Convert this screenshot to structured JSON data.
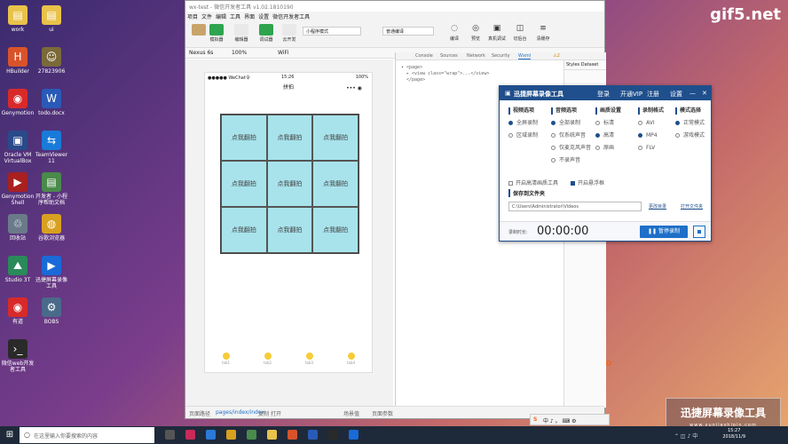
{
  "desktop": {
    "icons": [
      {
        "label": "work",
        "glyph": "▤",
        "color": "#e8c24a"
      },
      {
        "label": "ui",
        "glyph": "▤",
        "color": "#e8c24a"
      },
      {
        "label": "HBuilder",
        "glyph": "H",
        "color": "#d9532a"
      },
      {
        "label": "27823906",
        "glyph": "☺",
        "color": "#7a6a3a"
      },
      {
        "label": "Genymotion",
        "glyph": "◉",
        "color": "#d92a2a"
      },
      {
        "label": "todo.docx",
        "glyph": "W",
        "color": "#2a5ab8"
      },
      {
        "label": "Oracle VM VirtualBox",
        "glyph": "▣",
        "color": "#2a4a8a"
      },
      {
        "label": "TeamViewer 11",
        "glyph": "⇆",
        "color": "#1a7ad8"
      },
      {
        "label": "Genymotion Shell",
        "glyph": "▶",
        "color": "#a82020"
      },
      {
        "label": "开发者 - 小程序帮助文档",
        "glyph": "▤",
        "color": "#4a8a4a"
      },
      {
        "label": "回收站",
        "glyph": "♲",
        "color": "#6a7a8a"
      },
      {
        "label": "谷歌浏览器",
        "glyph": "◍",
        "color": "#d8a020"
      },
      {
        "label": "Studio 3T",
        "glyph": "⛰",
        "color": "#2a8a5a"
      },
      {
        "label": "迅捷屏幕录像工具",
        "glyph": "▶",
        "color": "#1a6ad8"
      },
      {
        "label": "有道",
        "glyph": "◉",
        "color": "#d82a2a"
      },
      {
        "label": "BOBS",
        "glyph": "⚙",
        "color": "#4a6a8a"
      },
      {
        "label": "微信web开发者工具",
        "glyph": "›_",
        "color": "#2a2a2a"
      }
    ],
    "watermark_top": "gif5.net",
    "watermark_bottom": "迅捷屏幕录像工具",
    "watermark_bottom_sub": "www.xunjieshipin.com",
    "orange_logo": "o"
  },
  "ide": {
    "title": "wx-test - 微信开发者工具 v1.02.1810190",
    "menu": [
      "项目",
      "文件",
      "编辑",
      "工具",
      "界面",
      "设置",
      "微信开发者工具"
    ],
    "toolbar": {
      "buttons": [
        {
          "label": "模拟器",
          "color": "#2ea44f"
        },
        {
          "label": "编辑器",
          "color": "#e9e9e9"
        },
        {
          "label": "调试器",
          "color": "#2ea44f"
        },
        {
          "label": "云开发",
          "color": "#e9e9e9"
        }
      ],
      "mode_select": "小程序模式",
      "compile_select": "普通编译",
      "right_buttons": [
        "编译",
        "预览",
        "真机调试",
        "切后台",
        "清缓存"
      ]
    },
    "sim_bar": {
      "device": "Nexus 6s",
      "zoom": "100%",
      "network": "WiFi"
    },
    "phone": {
      "status_left": "●●●●● WeChat令",
      "status_time": "15:26",
      "status_right": "100%",
      "nav_title": "拼拍",
      "capsule": "•••  ◉",
      "cells": [
        "点我翻拍",
        "点我翻拍",
        "点我翻拍",
        "点我翻拍",
        "点我翻拍",
        "点我翻拍",
        "点我翻拍",
        "点我翻拍",
        "点我翻拍"
      ],
      "tabs": [
        "tab1",
        "tab2",
        "tab3",
        "tab4"
      ]
    },
    "devtools": {
      "tabs": [
        "Console",
        "Sources",
        "Network",
        "Security",
        "Wxml"
      ],
      "active_tab": "Wxml",
      "code_lines": [
        "▾ <page>",
        "  ▸ <view class=\"wrap\">...</view>",
        "  </page>"
      ],
      "styles_tabs": "Styles  Dataset",
      "warnings": "⚠2"
    },
    "status": {
      "left": "页面路径",
      "path": "pages/index/index",
      "copy": "复制",
      "open": "打开",
      "scene": "场景值",
      "params": "页面参数"
    }
  },
  "recorder": {
    "title": "迅捷屏幕录像工具",
    "header_links": [
      "登录",
      "开通VIP",
      "注册",
      "设置"
    ],
    "columns": [
      {
        "head": "视频选项",
        "options": [
          {
            "label": "全屏录制",
            "on": true
          },
          {
            "label": "区域录制",
            "on": false
          }
        ]
      },
      {
        "head": "音频选项",
        "options": [
          {
            "label": "全部录制",
            "on": true
          },
          {
            "label": "仅系统声音",
            "on": false
          },
          {
            "label": "仅麦克风声音",
            "on": false
          },
          {
            "label": "不录声音",
            "on": false
          }
        ]
      },
      {
        "head": "画质设置",
        "options": [
          {
            "label": "标清",
            "on": false
          },
          {
            "label": "高清",
            "on": true
          },
          {
            "label": "原画",
            "on": false
          }
        ]
      },
      {
        "head": "录制格式",
        "options": [
          {
            "label": "AVI",
            "on": false
          },
          {
            "label": "MP4",
            "on": true
          },
          {
            "label": "FLV",
            "on": false
          }
        ]
      },
      {
        "head": "模式选择",
        "options": [
          {
            "label": "正常模式",
            "on": true
          },
          {
            "label": "游戏模式",
            "on": false
          }
        ]
      }
    ],
    "checks": [
      {
        "label": "开启高清画质工具",
        "on": false
      },
      {
        "label": "开启悬浮框",
        "on": true
      }
    ],
    "save_label": "保存到文件夹",
    "save_path": "C:\\Users\\Administrator\\Videos",
    "change_dir": "更改目录",
    "open_folder": "打开文件夹",
    "timer_label": "录制时长:",
    "timer": "00:00:00",
    "stop_label": "暂停录制"
  },
  "taskbar": {
    "search_placeholder": "在这里输入你要搜索的内容",
    "time": "15:27",
    "date": "2018/11/9",
    "ime": "中 ♪ 。 ⌨ ⚙"
  }
}
